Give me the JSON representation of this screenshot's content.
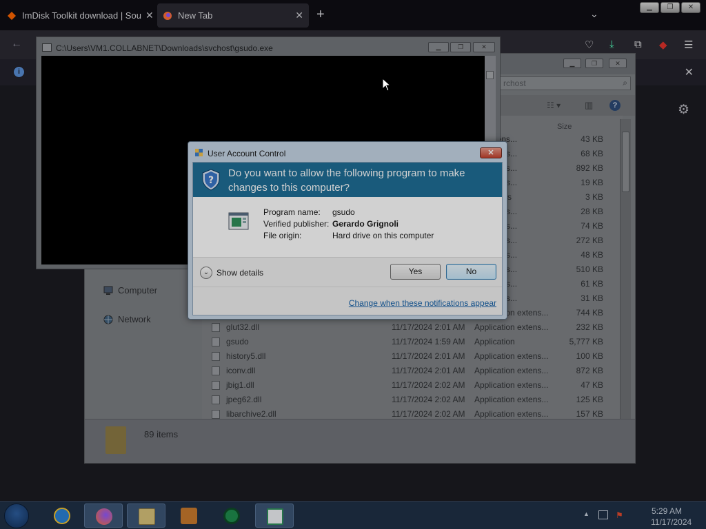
{
  "firefox": {
    "tabs": [
      {
        "label": "ImDisk Toolkit download | Sou",
        "active": false
      },
      {
        "label": "New Tab",
        "active": true
      }
    ],
    "new_tab": "+",
    "tab_list": "⌄",
    "close_glyph": "✕",
    "info_glyph": "i"
  },
  "explorer": {
    "search_placeholder": "rchost",
    "size_header": "Size",
    "sidebar": [
      {
        "label": "Computer",
        "icon": "computer-icon"
      },
      {
        "label": "Network",
        "icon": "network-icon"
      }
    ],
    "files": [
      {
        "name": "",
        "date": "",
        "type": "on extens...",
        "size": "43 KB"
      },
      {
        "name": "",
        "date": "",
        "type": "on extens...",
        "size": "68 KB"
      },
      {
        "name": "",
        "date": "",
        "type": "on extens...",
        "size": "892 KB"
      },
      {
        "name": "",
        "date": "",
        "type": "on extens...",
        "size": "19 KB"
      },
      {
        "name": "",
        "date": "",
        "type": "on Entries",
        "size": "3 KB"
      },
      {
        "name": "",
        "date": "",
        "type": "on extens...",
        "size": "28 KB"
      },
      {
        "name": "",
        "date": "",
        "type": "on extens...",
        "size": "74 KB"
      },
      {
        "name": "",
        "date": "",
        "type": "on extens...",
        "size": "272 KB"
      },
      {
        "name": "",
        "date": "",
        "type": "on extens...",
        "size": "48 KB"
      },
      {
        "name": "",
        "date": "",
        "type": "on extens...",
        "size": "510 KB"
      },
      {
        "name": "",
        "date": "",
        "type": "on extens...",
        "size": "61 KB"
      },
      {
        "name": "",
        "date": "",
        "type": "on extens...",
        "size": "31 KB"
      },
      {
        "name": "gipk.dll",
        "date": "11/17/2024 2:01 AM",
        "type": "Application extens...",
        "size": "744 KB"
      },
      {
        "name": "glut32.dll",
        "date": "11/17/2024 2:01 AM",
        "type": "Application extens...",
        "size": "232 KB"
      },
      {
        "name": "gsudo",
        "date": "11/17/2024 1:59 AM",
        "type": "Application",
        "size": "5,777 KB"
      },
      {
        "name": "history5.dll",
        "date": "11/17/2024 2:01 AM",
        "type": "Application extens...",
        "size": "100 KB"
      },
      {
        "name": "iconv.dll",
        "date": "11/17/2024 2:01 AM",
        "type": "Application extens...",
        "size": "872 KB"
      },
      {
        "name": "jbig1.dll",
        "date": "11/17/2024 2:02 AM",
        "type": "Application extens...",
        "size": "47 KB"
      },
      {
        "name": "jpeg62.dll",
        "date": "11/17/2024 2:02 AM",
        "type": "Application extens...",
        "size": "125 KB"
      },
      {
        "name": "libarchive2.dll",
        "date": "11/17/2024 2:02 AM",
        "type": "Application extens...",
        "size": "157 KB"
      }
    ],
    "item_count": "89 items"
  },
  "console": {
    "title": "C:\\Users\\VM1.COLLABNET\\Downloads\\svchost\\gsudo.exe"
  },
  "uac": {
    "title": "User Account Control",
    "question": "Do you want to allow the following program to make changes to this computer?",
    "fields": [
      {
        "label": "Program name:",
        "value": "gsudo"
      },
      {
        "label": "Verified publisher:",
        "value": "Gerardo Grignoli"
      },
      {
        "label": "File origin:",
        "value": "Hard drive on this computer"
      }
    ],
    "show_details": "Show details",
    "yes": "Yes",
    "no": "No",
    "link": "Change when these notifications appear",
    "close_glyph": "✕",
    "chevron": "⌄",
    "colors": {
      "banner": "#1f6e96",
      "link": "#1460a8"
    }
  },
  "taskbar": {
    "clock_time": "5:29 AM",
    "clock_date": "11/17/2024",
    "items": [
      "internet-explorer-icon",
      "firefox-icon",
      "file-explorer-icon",
      "media-player-icon",
      "refresh-app-icon",
      "gsudo-console-icon"
    ]
  }
}
